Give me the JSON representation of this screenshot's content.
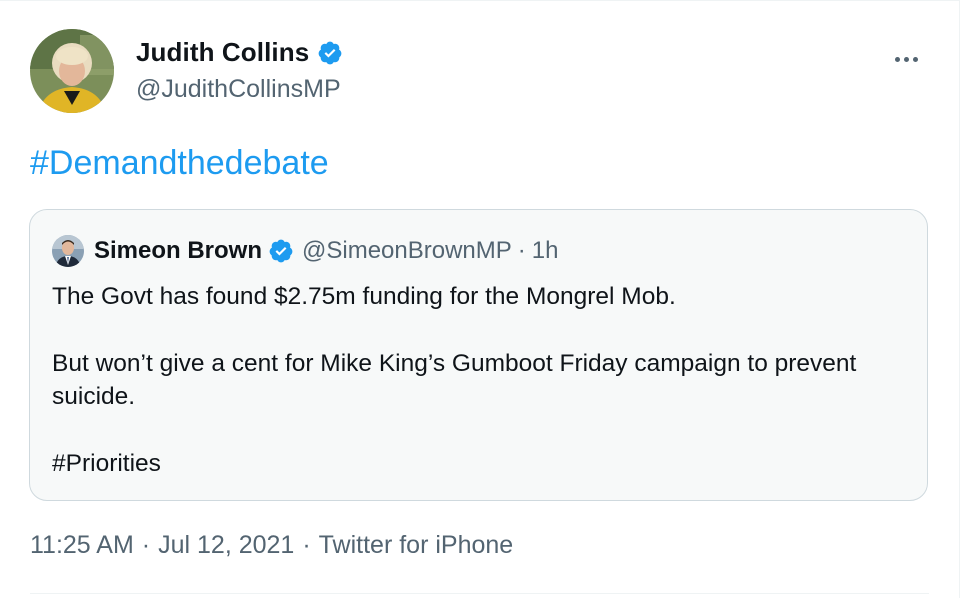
{
  "author": {
    "name": "Judith Collins",
    "handle": "@JudithCollinsMP",
    "verified": true
  },
  "tweet": {
    "hashtag": "#Demandthedebate",
    "time": "11:25 AM",
    "date": "Jul 12, 2021",
    "source": "Twitter for iPhone",
    "separator": "·"
  },
  "quoted": {
    "name": "Simeon Brown",
    "handle": "@SimeonBrownMP",
    "separator": "·",
    "time": "1h",
    "lines": [
      "The Govt has found $2.75m funding for the Mongrel Mob.",
      "But won’t give a cent for Mike King’s Gumboot Friday campaign to prevent suicide.",
      "#Priorities"
    ]
  },
  "icons": {
    "verified": "verified-badge-icon",
    "more": "more-options-icon"
  },
  "colors": {
    "accent": "#1d9bf0",
    "secondary_text": "#536471",
    "border": "#cfd9de",
    "quote_bg": "#f7f9f9"
  }
}
